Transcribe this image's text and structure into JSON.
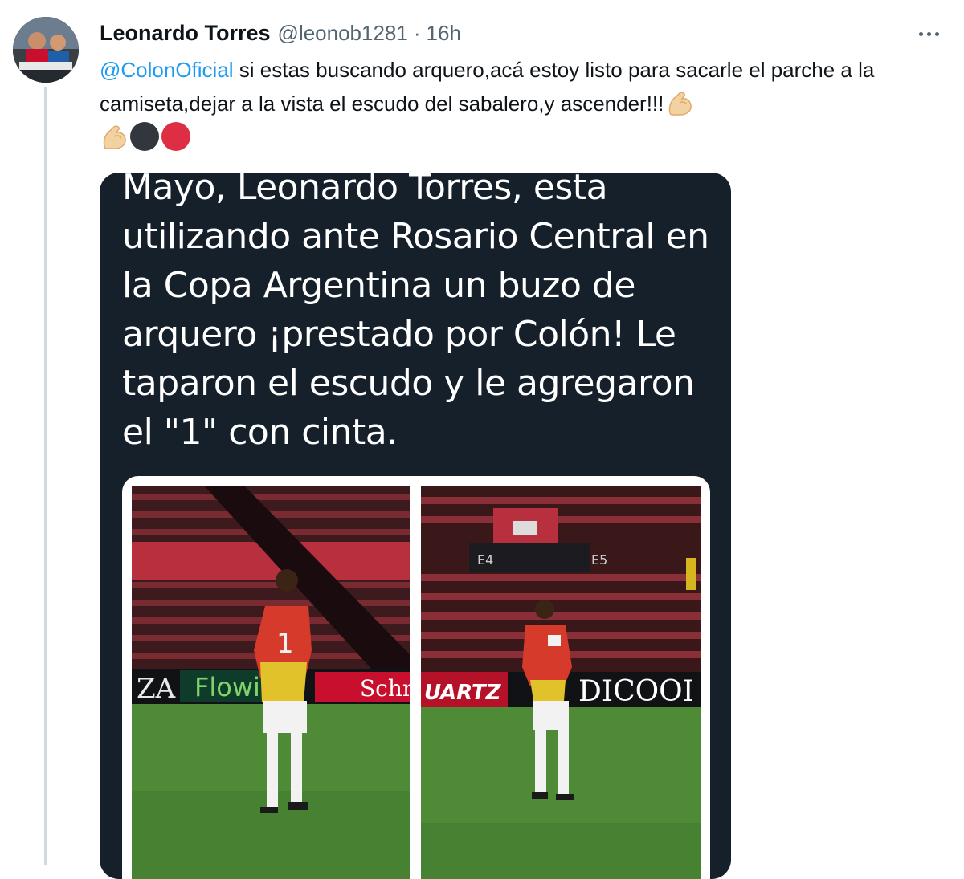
{
  "tweet": {
    "author_name": "Leonardo Torres",
    "author_handle": "@leonob1281",
    "separator": "·",
    "timestamp": "16h",
    "mention": "@ColonOficial",
    "text_body": " si estas buscando arquero,acá estoy listo para sacarle el parche a la camiseta,dejar a la vista el escudo del sabalero,y ascender!!!",
    "emojis": [
      "flexed-biceps",
      "flexed-biceps",
      "black-circle",
      "red-circle"
    ],
    "colors": {
      "mention": "#1d9bf0",
      "secondary_text": "#536471",
      "card_background": "#15202b"
    }
  },
  "media": {
    "text": "Mayo, Leonardo Torres, esta utilizando ante Rosario Central en la Copa Argentina un buzo de arquero ¡prestado por Colón! Le taparon el escudo y le agregaron el \"1\" con cinta.",
    "photos": [
      {
        "name": "goalkeeper-photo-left",
        "banners": [
          "ZA",
          "Flowi",
          "Schneid"
        ],
        "shirt_number": "1"
      },
      {
        "name": "goalkeeper-photo-right",
        "banners": [
          "UARTZ",
          "DICOOI"
        ],
        "seat_markers": [
          "E4",
          "E5"
        ]
      }
    ]
  }
}
